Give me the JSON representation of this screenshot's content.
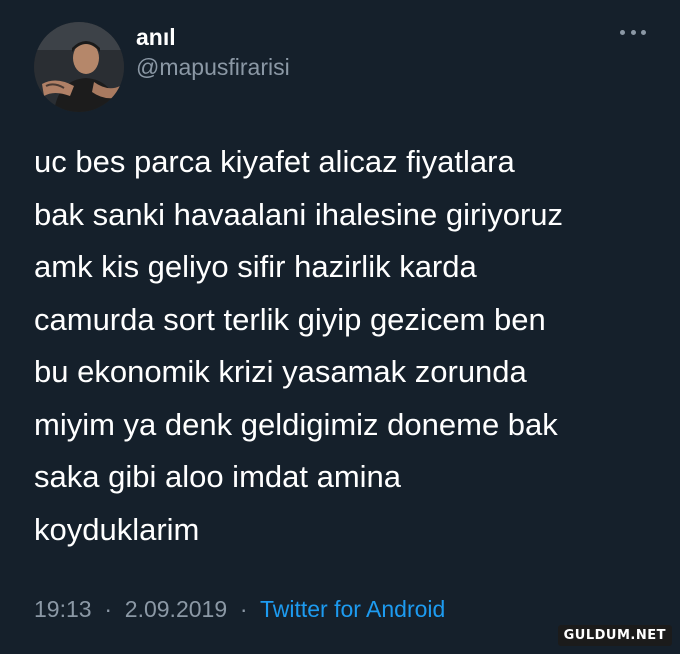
{
  "user": {
    "display_name": "anıl",
    "handle": "@mapusfirarisi",
    "avatar": "profile-photo"
  },
  "more_icon": "ellipsis-icon",
  "tweet": {
    "lines": [
      "uc bes parca kiyafet alicaz fiyatlara",
      "bak sanki havaalani ihalesine giriyoruz",
      "amk kis geliyo sifir hazirlik karda",
      "camurda sort terlik giyip gezicem ben",
      "bu ekonomik krizi yasamak zorunda",
      "miyim ya denk geldigimiz doneme bak",
      "saka gibi aloo imdat amina",
      "koyduklarim"
    ]
  },
  "meta": {
    "time": "19:13",
    "separator": "·",
    "date": "2.09.2019",
    "source": "Twitter for Android"
  },
  "watermark": "GULDUM.NET",
  "colors": {
    "background": "#15202b",
    "text": "#ffffff",
    "secondary": "#8b98a5",
    "link": "#1d9bf0"
  }
}
